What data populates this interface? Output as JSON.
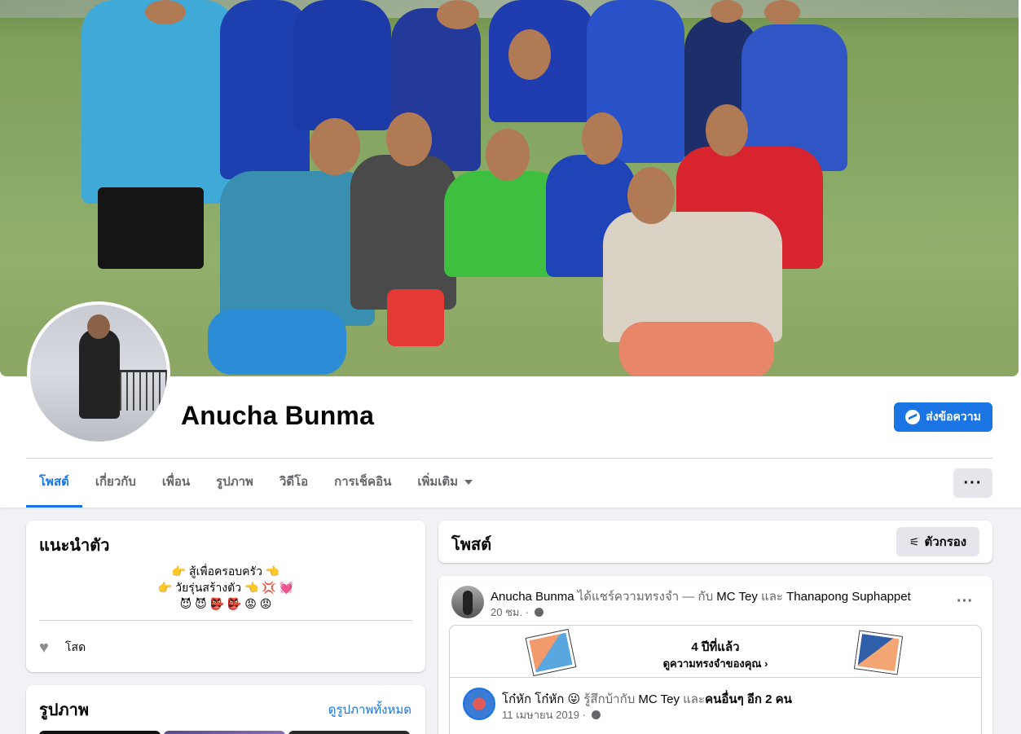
{
  "profile": {
    "name": "Anucha Bunma",
    "message_button": "ส่งข้อความ"
  },
  "tabs": [
    {
      "label": "โพสต์",
      "active": true
    },
    {
      "label": "เกี่ยวกับ"
    },
    {
      "label": "เพื่อน"
    },
    {
      "label": "รูปภาพ"
    },
    {
      "label": "วิดีโอ"
    },
    {
      "label": "การเช็คอิน"
    },
    {
      "label": "เพิ่มเติม"
    }
  ],
  "more_button": "···",
  "intro": {
    "title": "แนะนำตัว",
    "bio_lines": [
      "👉 สู้เพื่อครอบครัว 👈",
      "👉 วัยรุ่นสร้างตัว 👈 💢 💓",
      "😈 😈 👺 👺 😡 😡"
    ],
    "relationship": "โสด"
  },
  "photos": {
    "title": "รูปภาพ",
    "see_all": "ดูรูปภาพทั้งหมด"
  },
  "posts_header": {
    "title": "โพสต์",
    "filter_button": "ตัวกรอง"
  },
  "post": {
    "author": "Anucha Bunma",
    "action": " ได้แชร์ความทรงจำ — กับ ",
    "tag1": "MC Tey",
    "conj": " และ ",
    "tag2": "Thanapong Suphappet",
    "time": "20 ชม. ·",
    "menu": "···",
    "memory": {
      "years": "4 ปีที่แล้ว",
      "link": "ดูความทรงจำของคุณ ›"
    },
    "shared": {
      "author": "โก๋หัก โก๋หัก 😜",
      "feeling": " รู้สึกบ้ากับ ",
      "tag": "MC Tey",
      "conj": " และ",
      "others": "คนอื่นๆ อีก 2 คน",
      "date": "11 เมษายน 2019 ·"
    }
  },
  "colors": {
    "accent": "#1b74e4",
    "background": "#f0f2f5",
    "secondary_text": "#65676b"
  },
  "icons": [
    "messenger-icon",
    "heart-icon",
    "filter-icon",
    "globe-icon",
    "caret-down-icon",
    "more-dots-icon"
  ]
}
